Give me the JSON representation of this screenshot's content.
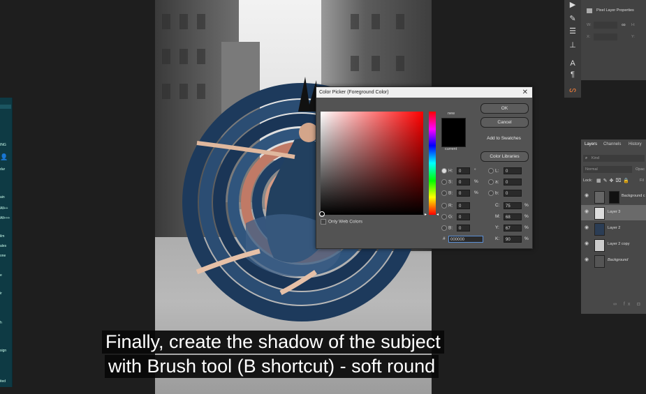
{
  "dialog": {
    "title": "Color Picker (Foreground Color)",
    "close_label": "✕",
    "new_label": "new",
    "current_label": "current",
    "ok_label": "OK",
    "cancel_label": "Cancel",
    "add_swatches_label": "Add to Swatches",
    "color_libraries_label": "Color Libraries",
    "only_web_colors_label": "Only Web Colors",
    "hsb": [
      {
        "label": "H:",
        "value": "0",
        "unit": "°"
      },
      {
        "label": "S:",
        "value": "0",
        "unit": "%"
      },
      {
        "label": "B:",
        "value": "0",
        "unit": "%"
      }
    ],
    "rgb": [
      {
        "label": "R:",
        "value": "0"
      },
      {
        "label": "G:",
        "value": "0"
      },
      {
        "label": "B:",
        "value": "0"
      }
    ],
    "lab": [
      {
        "label": "L:",
        "value": "0"
      },
      {
        "label": "a:",
        "value": "0"
      },
      {
        "label": "b:",
        "value": "0"
      }
    ],
    "cmyk": [
      {
        "label": "C:",
        "value": "75",
        "unit": "%"
      },
      {
        "label": "M:",
        "value": "68",
        "unit": "%"
      },
      {
        "label": "Y:",
        "value": "67",
        "unit": "%"
      },
      {
        "label": "K:",
        "value": "90",
        "unit": "%"
      }
    ],
    "hex_label": "#",
    "hex_value": "000000"
  },
  "properties": {
    "title": "Pixel Layer Properties",
    "w_label": "W:",
    "h_label": "H:",
    "x_label": "X:",
    "y_label": "Y:"
  },
  "layers_panel": {
    "tabs": [
      "Layers",
      "Channels",
      "History"
    ],
    "search_placeholder": "Kind",
    "blend_mode": "Normal",
    "opacity_label": "Opac",
    "lock_label": "Lock:",
    "fill_label": "Fil",
    "layers": [
      {
        "name": "Background c"
      },
      {
        "name": "Layer 3"
      },
      {
        "name": "Layer 2"
      },
      {
        "name": "Layer 2 copy"
      },
      {
        "name": "Background"
      }
    ]
  },
  "left_panel": {
    "items": [
      "ING",
      "dur",
      "ain",
      "All++",
      "All+++",
      "ilm",
      "ales",
      "one",
      "e",
      "ir",
      "h",
      "sign",
      "ited"
    ]
  },
  "subtitles": [
    "Finally, create the shadow of the subject",
    "with Brush tool (B shortcut) - soft round"
  ],
  "colors": {
    "foreground": "#000000",
    "dialog_bg": "#535353",
    "panel_bg": "#484848",
    "accent_teal": "#0e3a44"
  }
}
